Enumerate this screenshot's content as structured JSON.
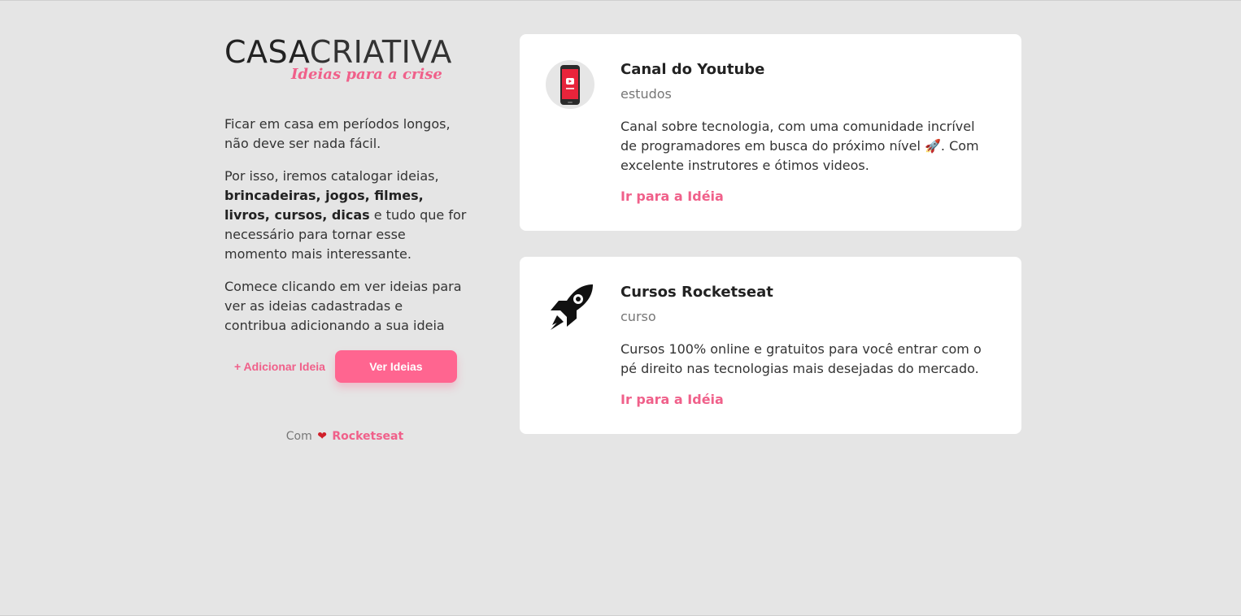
{
  "logo": {
    "main_bold": "CASA",
    "main_thin": "CRIATIVA",
    "tagline": "Ideias para a crise"
  },
  "intro": {
    "p1": "Ficar em casa em períodos longos, não deve ser nada fácil.",
    "p2_start": "Por isso, iremos catalogar ideias, ",
    "p2_bold": "brincadeiras, jogos, filmes, livros, cursos, dicas",
    "p2_end": " e tudo que for necessário para tornar esse momento mais interessante.",
    "p3": "Comece clicando em ver ideias para ver as ideias cadastradas e contribua adicionando a sua ideia"
  },
  "actions": {
    "add_label": "+ Adicionar Ideia",
    "see_label": "Ver Ideias"
  },
  "footer": {
    "prefix": "Com",
    "heart": "❤",
    "brand": "Rocketseat"
  },
  "ideas": [
    {
      "title": "Canal do Youtube",
      "category": "estudos",
      "description": "Canal sobre tecnologia, com uma comunidade incrível de programadores em busca do próximo nível 🚀. Com excelente instrutores e ótimos videos.",
      "link_label": "Ir para a Idéia",
      "icon": "youtube-phone-icon"
    },
    {
      "title": "Cursos Rocketseat",
      "category": "curso",
      "description": "Cursos 100% online e gratuitos para você entrar com o pé direito nas tecnologias mais desejadas do mercado.",
      "link_label": "Ir para a Idéia",
      "icon": "rocket-icon"
    }
  ],
  "colors": {
    "accent": "#ff6590",
    "background": "#e5e5e5",
    "card": "#ffffff"
  }
}
